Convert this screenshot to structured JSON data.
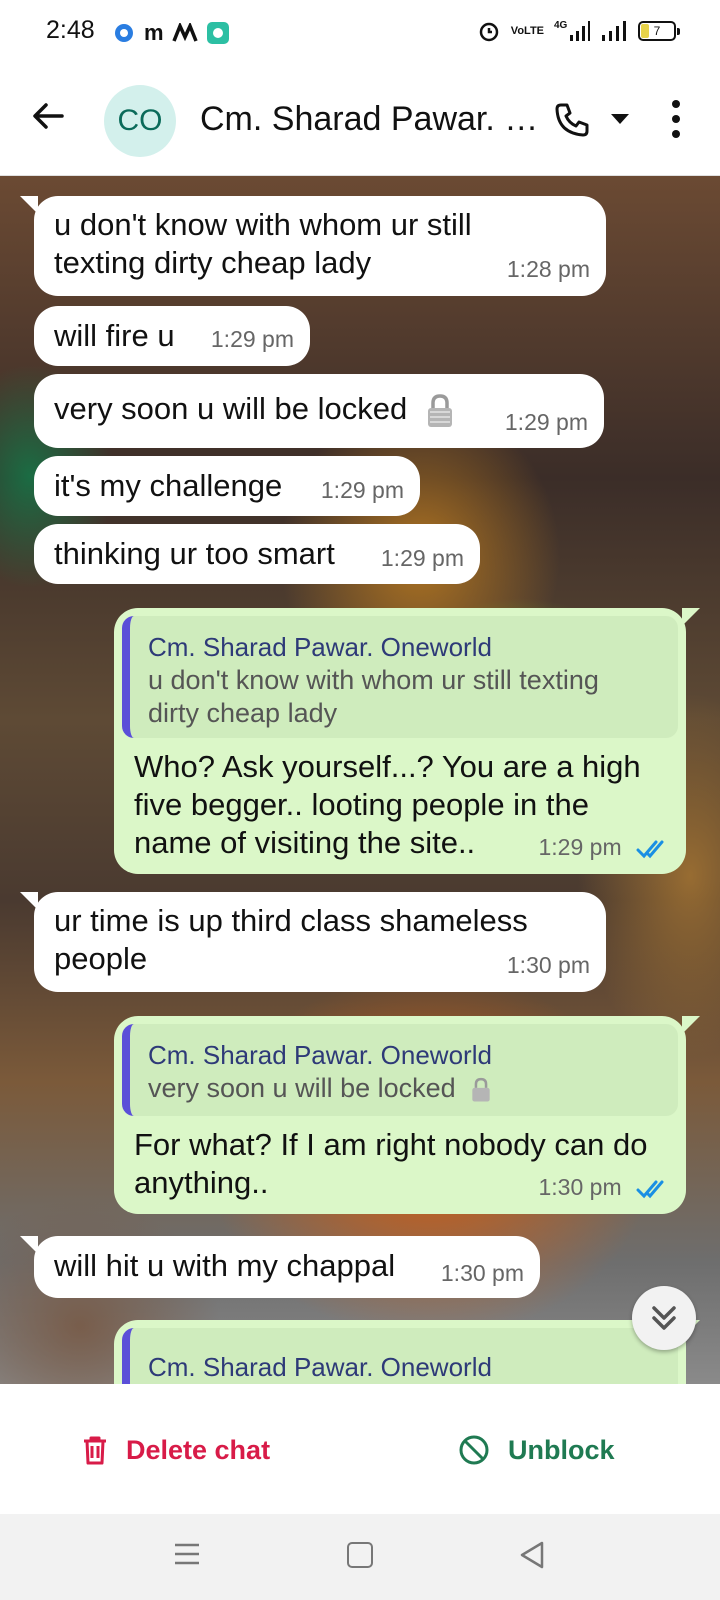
{
  "status_bar": {
    "time": "2:48",
    "network_label": "4G",
    "volte_label": "VoLTE",
    "battery_level": "7"
  },
  "header": {
    "avatar_initials": "CO",
    "contact_name": "Cm. Sharad Pawar. Oneworld",
    "icons": [
      "back-arrow-icon",
      "phone-icon",
      "dropdown-icon",
      "more-vert-icon"
    ]
  },
  "messages": [
    {
      "type": "incoming",
      "text": "u don't know with whom ur still texting dirty cheap lady",
      "time": "1:28 pm"
    },
    {
      "type": "incoming",
      "text": "will fire u",
      "time": "1:29 pm"
    },
    {
      "type": "incoming",
      "text": "very soon u will be locked",
      "time": "1:29 pm"
    },
    {
      "type": "incoming",
      "text": "it's my challenge",
      "time": "1:29 pm"
    },
    {
      "type": "incoming",
      "text": "thinking ur too smart",
      "time": "1:29 pm"
    },
    {
      "type": "outgoing",
      "quote_author": "Cm. Sharad Pawar. Oneworld",
      "quote_text": "u don't know with whom ur still texting dirty cheap lady",
      "text": "Who? Ask yourself...? You are a high five begger.. looting people in the name of visiting the site..",
      "time": "1:29 pm"
    },
    {
      "type": "incoming",
      "text": "ur time is up third class shameless people",
      "time": "1:30 pm"
    },
    {
      "type": "outgoing",
      "quote_author": "Cm. Sharad Pawar. Oneworld",
      "quote_text": "very soon u will be locked",
      "text": "For what? If I am right nobody can do anything..",
      "time": "1:30 pm"
    },
    {
      "type": "incoming",
      "text": "will hit u with my chappal",
      "time": "1:30 pm"
    },
    {
      "type": "outgoing",
      "quote_author": "Cm. Sharad Pawar. Oneworld"
    }
  ],
  "actions": {
    "delete_label": "Delete chat",
    "unblock_label": "Unblock"
  },
  "colors": {
    "incoming_bubble": "#ffffff",
    "outgoing_bubble": "#dbf7c8",
    "delete": "#d81b48",
    "unblock": "#1f7a52",
    "read_ticks": "#1a8fe3"
  }
}
